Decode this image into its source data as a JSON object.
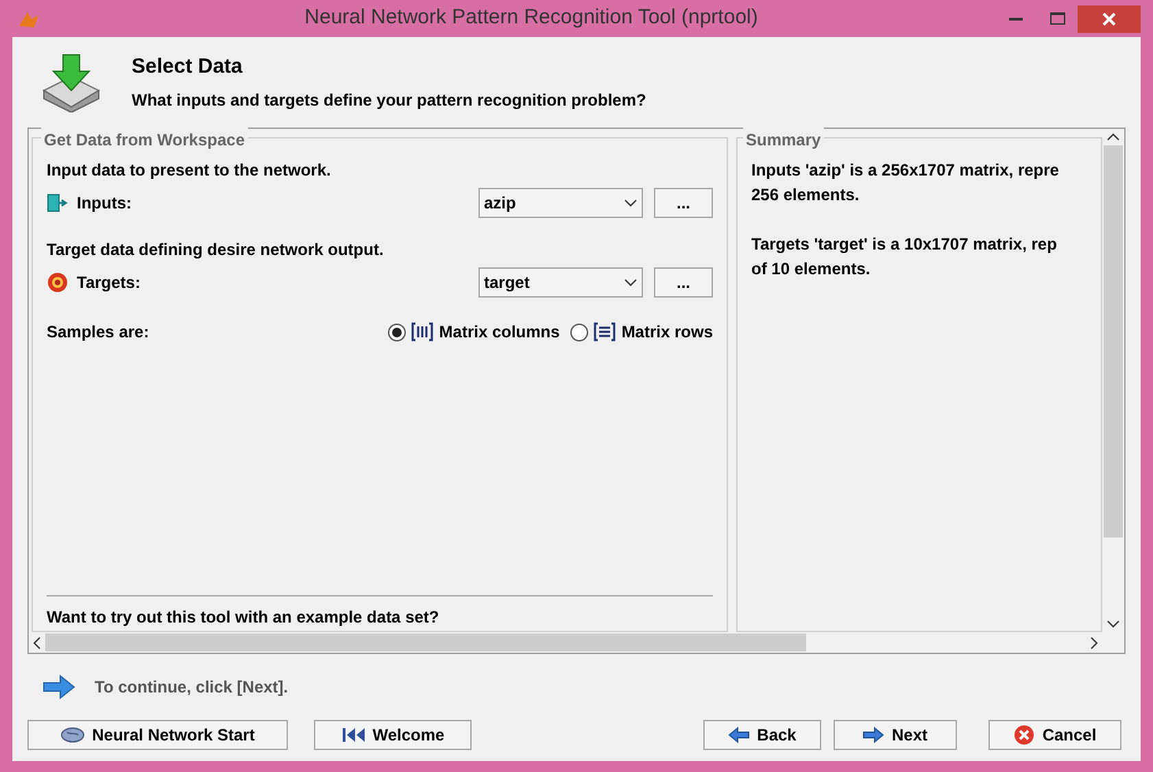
{
  "window": {
    "title": "Neural Network Pattern Recognition Tool (nprtool)"
  },
  "header": {
    "title": "Select Data",
    "subtitle": "What inputs and targets define your pattern recognition problem?"
  },
  "workspace": {
    "title": "Get Data from Workspace",
    "fields": [
      {
        "kind": "inputs",
        "prompt": "Input data to present to the network.",
        "label": "Inputs:",
        "value": "azip",
        "browse": "..."
      },
      {
        "kind": "targets",
        "prompt": "Target data defining desire network output.",
        "label": "Targets:",
        "value": "target",
        "browse": "..."
      }
    ],
    "samples": {
      "label": "Samples are:",
      "options": [
        {
          "kind": "columns",
          "label": "Matrix columns",
          "selected": true
        },
        {
          "kind": "rows",
          "label": "Matrix rows",
          "selected": false
        }
      ]
    },
    "example_prompt": "Want to try out this tool with an example data set?"
  },
  "summary": {
    "title": "Summary",
    "paragraphs": [
      [
        "Inputs 'azip' is a 256x1707 matrix, repre",
        "256 elements."
      ],
      [
        "Targets 'target' is a 10x1707 matrix, rep",
        "of 10 elements."
      ]
    ]
  },
  "hint": "To continue, click [Next].",
  "buttons": [
    {
      "kind": "start",
      "label": "Neural Network Start"
    },
    {
      "kind": "welcome",
      "label": "Welcome"
    },
    {
      "kind": "back",
      "label": "Back"
    },
    {
      "kind": "next",
      "label": "Next"
    },
    {
      "kind": "cancel",
      "label": "Cancel"
    }
  ]
}
